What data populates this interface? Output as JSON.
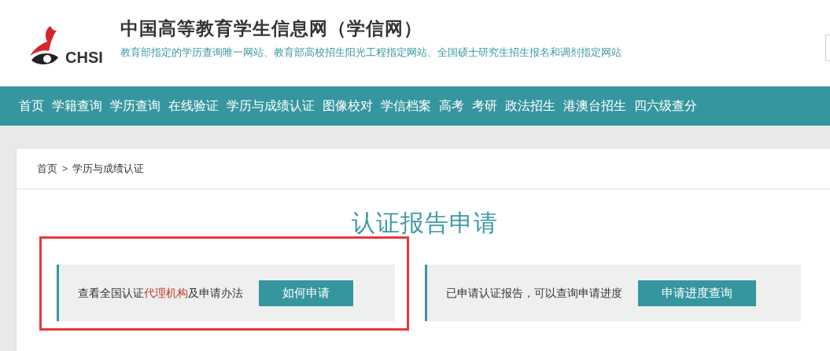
{
  "header": {
    "logo_text": "CHSI",
    "title": "中国高等教育学生信息网（学信网）",
    "subtitle": "教育部指定的学历查询唯一网站、教育部高校招生阳光工程指定网站、全国硕士研究生招生报名和调剂指定网站"
  },
  "nav": {
    "items": [
      {
        "label": "首页"
      },
      {
        "label": "学籍查询"
      },
      {
        "label": "学历查询"
      },
      {
        "label": "在线验证"
      },
      {
        "label": "学历与成绩认证"
      },
      {
        "label": "图像校对"
      },
      {
        "label": "学信档案"
      },
      {
        "label": "高考"
      },
      {
        "label": "考研"
      },
      {
        "label": "政法招生"
      },
      {
        "label": "港澳台招生"
      },
      {
        "label": "四六级查分"
      }
    ]
  },
  "breadcrumb": {
    "items": [
      {
        "label": "首页"
      },
      {
        "label": "学历与成绩认证"
      }
    ],
    "separator": ">"
  },
  "page_title": "认证报告申请",
  "cards": [
    {
      "text_before": "查看全国认证",
      "link": "代理机构",
      "text_after": "及申请办法",
      "button": "如何申请",
      "highlighted": true
    },
    {
      "text_before": "已申请认证报告，可以查询申请进度",
      "button": "申请进度查询",
      "highlighted": false
    }
  ]
}
